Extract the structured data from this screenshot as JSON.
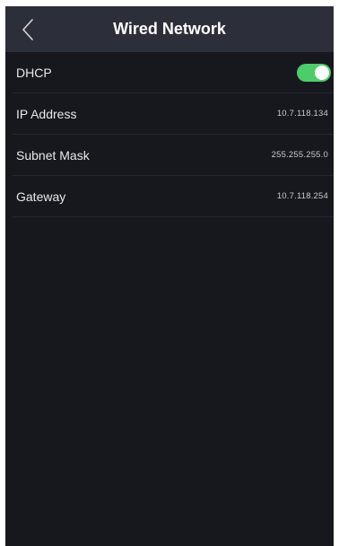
{
  "header": {
    "title": "Wired Network",
    "back_icon": "chevron-left-icon"
  },
  "settings": [
    {
      "id": "dhcp",
      "label": "DHCP",
      "type": "toggle",
      "enabled": true
    },
    {
      "id": "ip-address",
      "label": "IP Address",
      "value": "10.7.118.134"
    },
    {
      "id": "subnet-mask",
      "label": "Subnet Mask",
      "value": "255.255.255.0"
    },
    {
      "id": "gateway",
      "label": "Gateway",
      "value": "10.7.118.254"
    }
  ],
  "colors": {
    "background": "#17181d",
    "header": "#2c2e39",
    "toggle_on": "#4ccd6a",
    "divider": "#262830"
  }
}
